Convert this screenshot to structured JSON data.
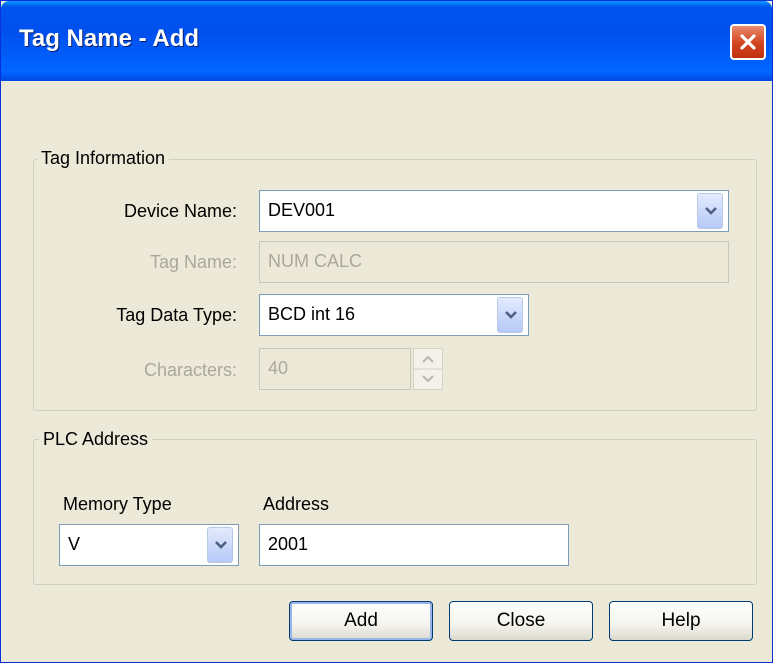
{
  "window": {
    "title": "Tag Name - Add"
  },
  "tag_information": {
    "group_label": "Tag Information",
    "device_name": {
      "label": "Device Name:",
      "value": "DEV001"
    },
    "tag_name": {
      "label": "Tag Name:",
      "value": "NUM CALC"
    },
    "tag_data_type": {
      "label": "Tag Data Type:",
      "value": "BCD int 16"
    },
    "characters": {
      "label": "Characters:",
      "value": "40"
    }
  },
  "plc_address": {
    "group_label": "PLC Address",
    "memory_type": {
      "label": "Memory Type",
      "value": "V"
    },
    "address": {
      "label": "Address",
      "value": "2001"
    }
  },
  "buttons": {
    "add": "Add",
    "close": "Close",
    "help": "Help"
  },
  "icons": {
    "close": "close-icon",
    "dropdown": "chevron-down-icon",
    "spin_up": "spin-up-icon",
    "spin_down": "spin-down-icon"
  },
  "colors": {
    "titlebar": "#0054e3",
    "window_bg": "#ece9d8",
    "disabled_text": "#aca899",
    "close_button": "#d24420"
  }
}
